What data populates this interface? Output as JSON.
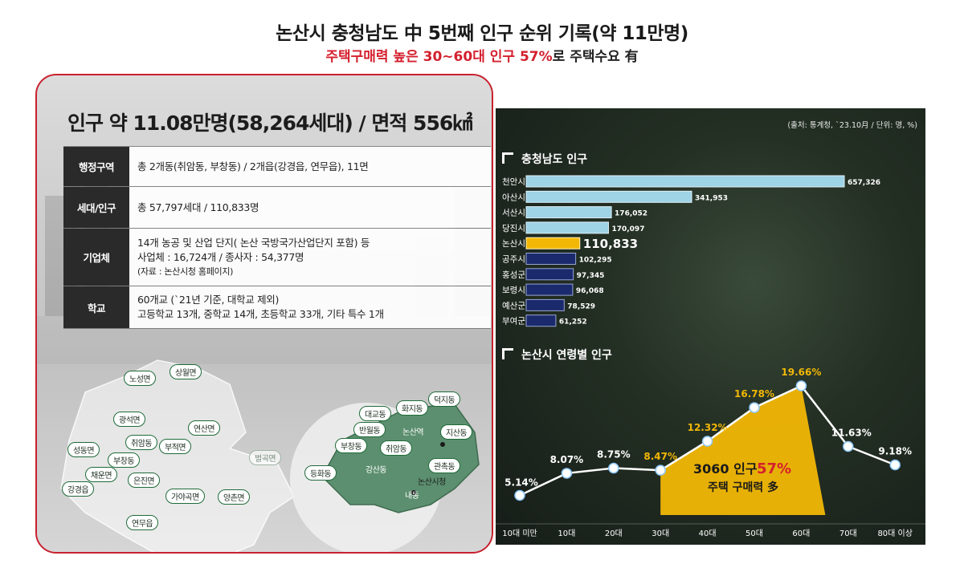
{
  "header": {
    "title": "논산시 충청남도 中 5번째 인구 순위 기록(약 11만명)",
    "subtitle_red": "주택구매력 높은 30~60대 인구 57%",
    "subtitle_rest": "로 주택수요 有"
  },
  "left_panel": {
    "title": "인구 약 11.08만명(58,264세대) / 면적 556㎢",
    "rows": [
      {
        "head": "행정구역",
        "lines": [
          "총 2개동(취암동, 부창동) / 2개읍(강경읍, 연무읍), 11면"
        ]
      },
      {
        "head": "세대/인구",
        "lines": [
          "총 57,797세대 / 110,833명"
        ]
      },
      {
        "head": "기업체",
        "lines": [
          "14개 농공 및 산업 단지( 논산 국방국가산업단지 포함) 등",
          "사업체 : 16,724개 / 종사자 : 54,377명",
          "(자료 : 논산시청 홈페이지)"
        ]
      },
      {
        "head": "학교",
        "lines": [
          "60개교 (`21년 기준, 대학교 제외)",
          "고등학교 13개, 중학교 14개, 초등학교 33개, 기타 특수 1개"
        ]
      }
    ],
    "map_labels": [
      "노성면",
      "상월면",
      "광석면",
      "연산면",
      "취암동",
      "부적면",
      "성동면",
      "부창동",
      "벌곡면",
      "채운면",
      "은진면",
      "강경읍",
      "가야곡면",
      "양촌면",
      "연무읍"
    ],
    "inset_labels": [
      "대교동",
      "화지동",
      "덕지동",
      "반월동",
      "논산역",
      "지산동",
      "부창동",
      "취암동",
      "등화동",
      "강산동",
      "관촉동",
      "논산시청",
      "내동"
    ]
  },
  "right_panel": {
    "source": "(출처: 통계청, `23.10月 / 단위: 명, %)",
    "bar_title": "충청남도 인구",
    "line_title": "논산시 연령별 인구",
    "callout_line1_prefix": "3060 인구 ",
    "callout_line1_pct": "57%",
    "callout_line2": "주택 구매력 多"
  },
  "colors": {
    "accent_red": "#d4202e",
    "highlight_yellow": "#f2b705",
    "bar_light": "#9fd3e6",
    "bar_dark": "#1a2a6c"
  },
  "chart_data": [
    {
      "type": "bar",
      "title": "충청남도 인구",
      "orientation": "horizontal",
      "categories": [
        "천안시",
        "아산시",
        "서산시",
        "당진시",
        "논산시",
        "공주시",
        "홍성군",
        "보령시",
        "예산군",
        "부여군"
      ],
      "values": [
        657326,
        341953,
        176052,
        170097,
        110833,
        102295,
        97345,
        96068,
        78529,
        61252
      ],
      "value_labels": [
        "657,326",
        "341,953",
        "176,052",
        "170,097",
        "110,833",
        "102,295",
        "97,345",
        "96,068",
        "78,529",
        "61,252"
      ],
      "highlight": "논산시"
    },
    {
      "type": "line",
      "title": "논산시 연령별 인구",
      "categories": [
        "10대 미만",
        "10대",
        "20대",
        "30대",
        "40대",
        "50대",
        "60대",
        "70대",
        "80대 이상"
      ],
      "values": [
        5.14,
        8.07,
        8.75,
        8.47,
        12.32,
        16.78,
        19.66,
        11.63,
        9.18
      ],
      "value_labels": [
        "5.14%",
        "8.07%",
        "8.75%",
        "8.47%",
        "12.32%",
        "16.78%",
        "19.66%",
        "11.63%",
        "9.18%"
      ],
      "highlight_range": [
        "30대",
        "60대"
      ]
    }
  ]
}
